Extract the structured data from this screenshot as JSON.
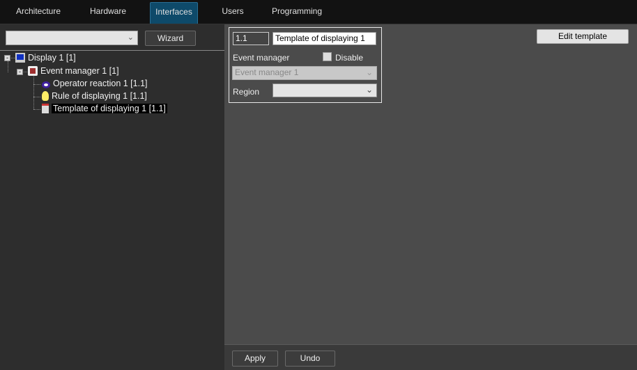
{
  "tabs": [
    {
      "label": "Architecture"
    },
    {
      "label": "Hardware"
    },
    {
      "label": "Interfaces",
      "active": true
    },
    {
      "label": "Users"
    },
    {
      "label": "Programming"
    }
  ],
  "left": {
    "selector_value": "",
    "wizard_label": "Wizard",
    "tree": [
      {
        "label": "Display 1 [1]",
        "icon": "monitor-icon"
      },
      {
        "label": "Event manager 1 [1]",
        "icon": "event-manager-icon"
      },
      {
        "label": "Operator reaction 1 [1.1]",
        "icon": "eye-icon"
      },
      {
        "label": "Rule of displaying 1 [1.1]",
        "icon": "lightbulb-icon"
      },
      {
        "label": "Template of displaying 1 [1.1]",
        "icon": "template-icon",
        "selected": true
      }
    ]
  },
  "form": {
    "id": "1.1",
    "name": "Template of displaying 1",
    "event_manager_label": "Event manager",
    "disable_label": "Disable",
    "disable_checked": false,
    "event_manager_value": "Event manager 1",
    "region_label": "Region",
    "region_value": ""
  },
  "edit_template_label": "Edit template",
  "footer": {
    "apply_label": "Apply",
    "undo_label": "Undo"
  }
}
